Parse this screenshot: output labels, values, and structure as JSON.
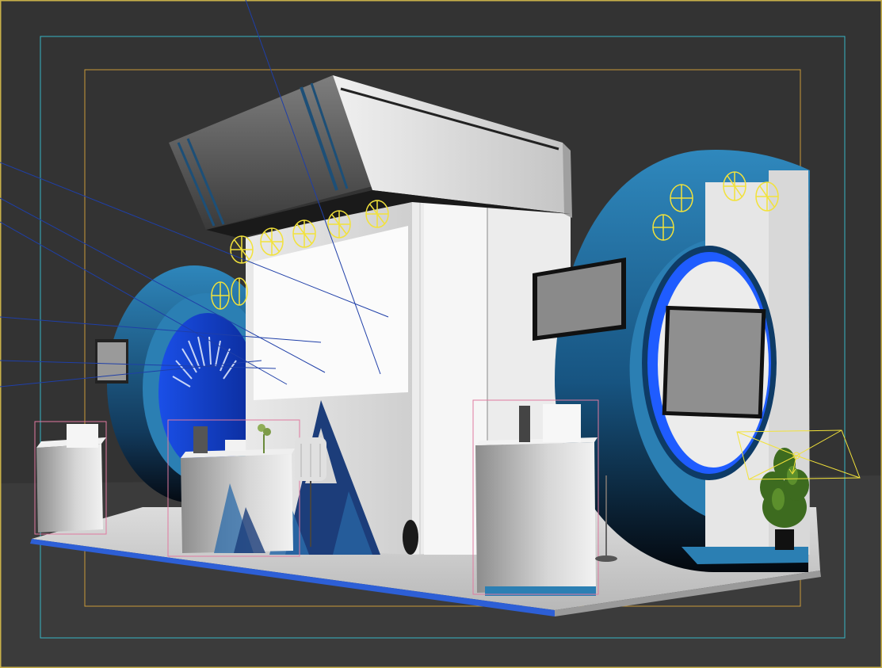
{
  "viewport": {
    "label": "",
    "colors": {
      "background": "#333333",
      "floor": "#3a3a3a",
      "active_border": "#c8b04a",
      "safe_frame_outer": "#37b6c4",
      "safe_frame_inner": "#c89a3a",
      "wireframe_light": "#f2e23a",
      "wire_blue": "#1f3fa8",
      "booth_blue": "#2b7fb3",
      "booth_dark_blue": "#0c2a44",
      "bright_blue": "#1f5cff",
      "white_panel": "#f4f4f4",
      "gray_panel": "#8a8a8a",
      "screen_gray": "#8f8f8f",
      "bbox_pink": "#e07aa0"
    }
  },
  "scene": {
    "objects": [
      "canopy-header",
      "left-ring-structure",
      "right-ring-structure",
      "center-wall",
      "left-counter",
      "front-desk",
      "right-counter",
      "potted-plant",
      "wall-monitors",
      "spotlights",
      "camera-gizmo",
      "light-rays"
    ]
  }
}
